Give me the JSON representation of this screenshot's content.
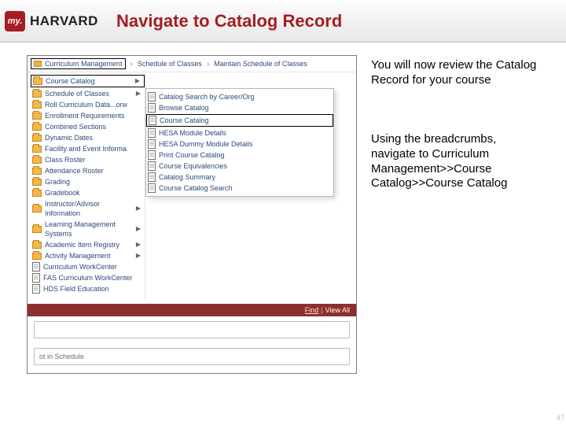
{
  "header": {
    "logo_my": "my.",
    "logo_text": "HARVARD",
    "title": "Navigate to Catalog Record"
  },
  "breadcrumbs": [
    "Curriculum Management",
    "Schedule of Classes",
    "Maintain Schedule of Classes"
  ],
  "left_items": [
    {
      "label": "Course Catalog",
      "icon": "folder",
      "boxed": true,
      "arrow": true
    },
    {
      "label": "Schedule of Classes",
      "icon": "folder",
      "arrow": true
    },
    {
      "label": "Roll Curriculum Data...orw",
      "icon": "folder"
    },
    {
      "label": "Enrollment Requirements",
      "icon": "folder"
    },
    {
      "label": "Combined Sections",
      "icon": "folder"
    },
    {
      "label": "Dynamic Dates",
      "icon": "folder"
    },
    {
      "label": "Facility and Event Informa",
      "icon": "folder"
    },
    {
      "label": "Class Roster",
      "icon": "folder"
    },
    {
      "label": "Attendance Roster",
      "icon": "folder"
    },
    {
      "label": "Grading",
      "icon": "folder"
    },
    {
      "label": "Gradebook",
      "icon": "folder"
    },
    {
      "label": "Instructor/Advisor Information",
      "icon": "folder",
      "arrow": true
    },
    {
      "label": "Learning Management Systems",
      "icon": "folder",
      "arrow": true
    },
    {
      "label": "Academic Item Registry",
      "icon": "folder",
      "arrow": true
    },
    {
      "label": "Activity Management",
      "icon": "folder",
      "arrow": true
    },
    {
      "label": "Curriculum WorkCenter",
      "icon": "doc"
    },
    {
      "label": "FAS Curriculum WorkCenter",
      "icon": "doc"
    },
    {
      "label": "HDS Field Education",
      "icon": "doc"
    }
  ],
  "right_items": [
    {
      "label": "Catalog Search by Career/Org",
      "icon": "doc"
    },
    {
      "label": "Browse Catalog",
      "icon": "doc"
    },
    {
      "label": "Course Catalog",
      "icon": "doc",
      "boxed": true
    },
    {
      "label": "HESA Module Details",
      "icon": "doc"
    },
    {
      "label": "HESA Dummy Module Details",
      "icon": "doc"
    },
    {
      "label": "Print Course Catalog",
      "icon": "doc"
    },
    {
      "label": "Course Equivalencies",
      "icon": "doc"
    },
    {
      "label": "Catalog Summary",
      "icon": "doc"
    },
    {
      "label": "Course Catalog Search",
      "icon": "doc"
    }
  ],
  "redband": {
    "find": "Find",
    "viewall": "View All"
  },
  "tiles": {
    "t1": "",
    "t2": "ot in Schedule"
  },
  "paragraphs": {
    "p1": "You will now review the Catalog Record for your course",
    "p2": "Using the breadcrumbs, navigate to Curriculum Management>>Course Catalog>>Course Catalog"
  },
  "page_number": "47"
}
